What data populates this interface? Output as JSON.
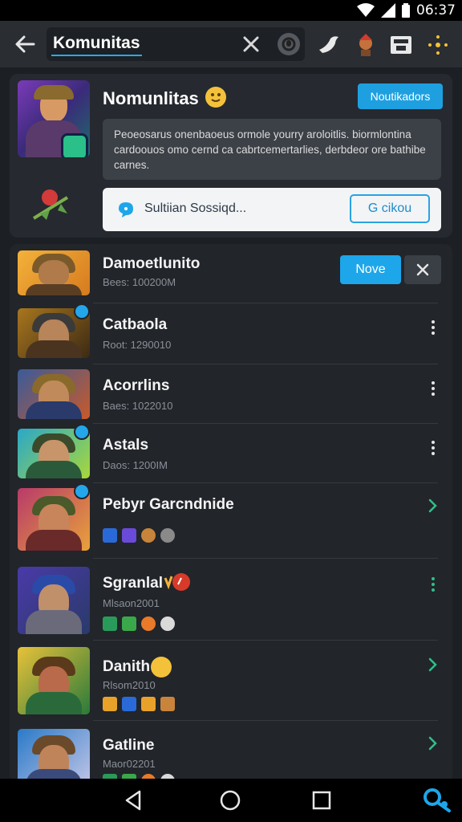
{
  "status": {
    "time": "06:37"
  },
  "search": {
    "query": "Komunitas"
  },
  "community": {
    "name": "Nomunlitas",
    "notif_button": "Noutikadors",
    "description": "Peoeosarus onenbaoeus ormole yourry aroloitlis. biormlontina cardoouos omo cernd ca cabrtcemertarlies, derbdeor ore bathibe carnes.",
    "shout_placeholder": "Sultiian Sossiqd...",
    "shout_button": "G cikou"
  },
  "list": {
    "rows": [
      {
        "title": "Damoetlunito",
        "sub": "Bees: 100200M",
        "move_label": "Nove"
      },
      {
        "title": "Catbaola",
        "sub": "Root: 1290010"
      },
      {
        "title": "Acorrlins",
        "sub": "Baes: 1022010"
      },
      {
        "title": "Astals",
        "sub": "Daos: 1200IM"
      },
      {
        "title": "Pebyr Garcndnide"
      },
      {
        "title": "Sgranlal",
        "sub": "Mlsaon2001"
      },
      {
        "title": "Danith",
        "sub": "Rlsom2010"
      },
      {
        "title": "Gatline",
        "sub": "Maor02201"
      }
    ]
  },
  "colors": {
    "accent": "#1ea6ea",
    "background": "#1c1f24",
    "card": "#26292f"
  }
}
